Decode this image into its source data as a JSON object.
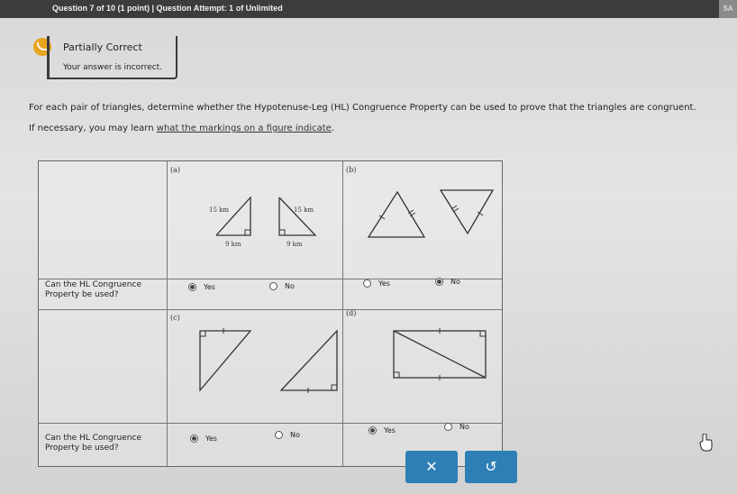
{
  "header": {
    "title": "Question 7 of 10 (1 point)  |  Question Attempt: 1 of Unlimited",
    "corner_text": "SA"
  },
  "status": {
    "title": "Partially Correct",
    "message": "Your answer is incorrect."
  },
  "instructions": {
    "line1": "For each pair of triangles, determine whether the Hypotenuse-Leg (HL) Congruence Property can be used to prove that the triangles are congruent.",
    "line2_prefix": "If necessary, you may learn ",
    "line2_link": "what the markings on a figure indicate",
    "line2_suffix": "."
  },
  "row_label": "Can the HL Congruence Property be used?",
  "parts": [
    {
      "letter": "(a)",
      "labels": {
        "hyp1": "15 km",
        "leg1": "9 km",
        "hyp2": "15 km",
        "leg2": "9 km"
      },
      "yes_label": "Yes",
      "no_label": "No",
      "selected": "Yes"
    },
    {
      "letter": "(b)",
      "yes_label": "Yes",
      "no_label": "No",
      "selected": "No"
    },
    {
      "letter": "(c)",
      "yes_label": "Yes",
      "no_label": "No",
      "selected": "Yes"
    },
    {
      "letter": "(d)",
      "yes_label": "Yes",
      "no_label": "No",
      "selected": "Yes"
    }
  ],
  "buttons": {
    "clear_symbol": "✕",
    "undo_symbol": "↺"
  },
  "colors": {
    "accent": "#2d7fb5",
    "status": "#e8a31f"
  }
}
